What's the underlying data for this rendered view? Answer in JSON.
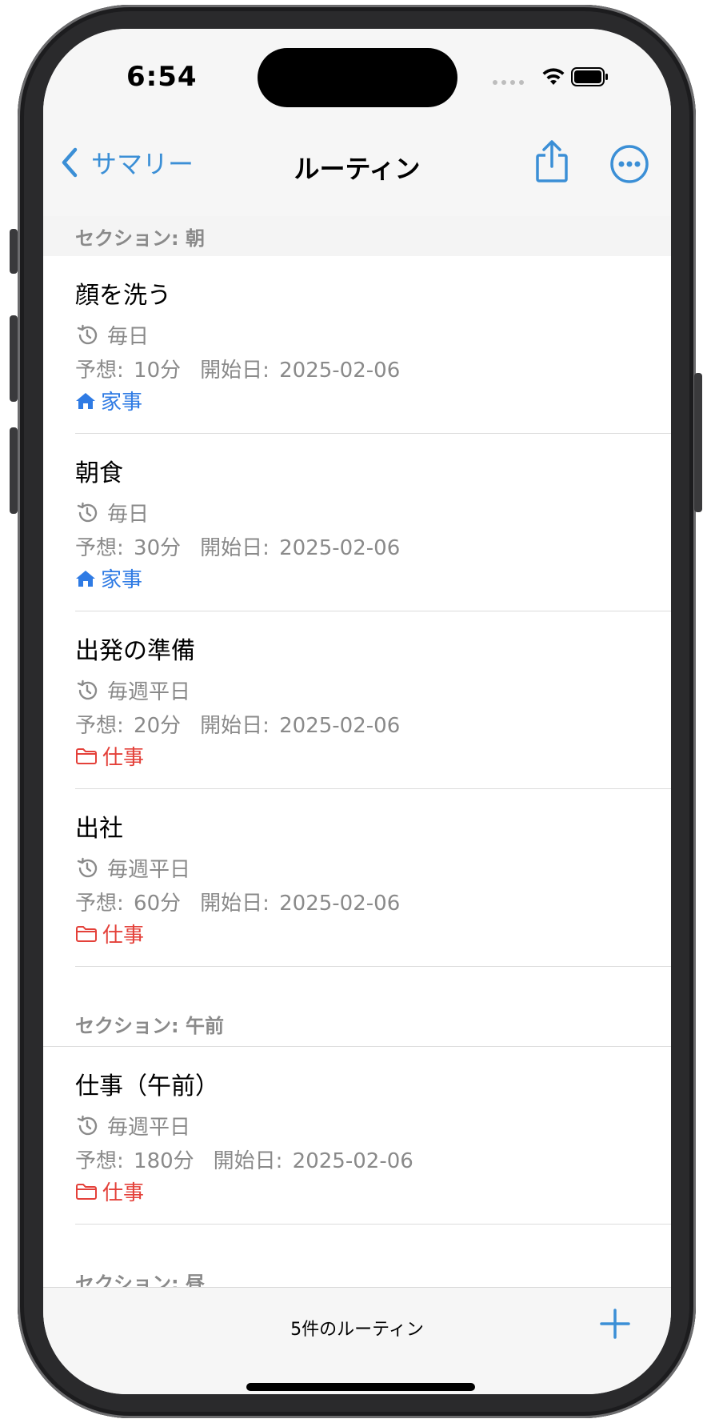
{
  "status_bar": {
    "time": "6:54"
  },
  "nav": {
    "back_label": "サマリー",
    "title": "ルーティン"
  },
  "sections": [
    {
      "header": "セクション: 朝",
      "rows": [
        {
          "title": "顔を洗う",
          "frequency": "毎日",
          "estimate": "予想: 10分",
          "start": "開始日: 2025-02-06",
          "tag": "家事",
          "tag_type": "home"
        },
        {
          "title": "朝食",
          "frequency": "毎日",
          "estimate": "予想: 30分",
          "start": "開始日: 2025-02-06",
          "tag": "家事",
          "tag_type": "home"
        },
        {
          "title": "出発の準備",
          "frequency": "毎週平日",
          "estimate": "予想: 20分",
          "start": "開始日: 2025-02-06",
          "tag": "仕事",
          "tag_type": "work"
        },
        {
          "title": "出社",
          "frequency": "毎週平日",
          "estimate": "予想: 60分",
          "start": "開始日: 2025-02-06",
          "tag": "仕事",
          "tag_type": "work"
        }
      ]
    },
    {
      "header": "セクション: 午前",
      "rows": [
        {
          "title": "仕事（午前）",
          "frequency": "毎週平日",
          "estimate": "予想: 180分",
          "start": "開始日: 2025-02-06",
          "tag": "仕事",
          "tag_type": "work"
        }
      ]
    },
    {
      "header": "セクション: 昼",
      "rows": []
    }
  ],
  "toolbar": {
    "count_label": "5件のルーティン"
  },
  "colors": {
    "accent": "#3b8fd6",
    "home_tag": "#2f7be4",
    "work_tag": "#e4413a",
    "secondary_text": "#8a8a8a"
  },
  "icons": {
    "back": "chevron-left-icon",
    "share": "share-icon",
    "more": "ellipsis-circle-icon",
    "frequency": "clock-history-icon",
    "home": "house-icon",
    "work": "folder-icon",
    "add": "plus-icon"
  }
}
